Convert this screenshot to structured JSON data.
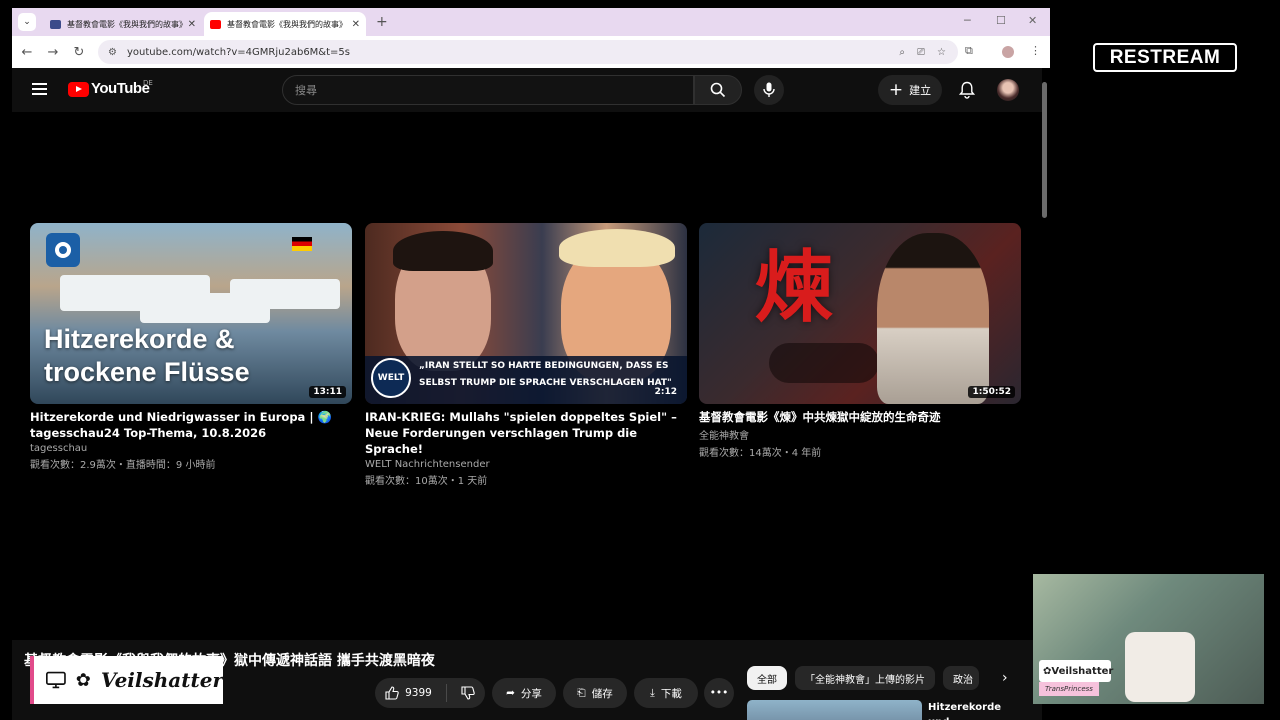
{
  "browser": {
    "tabs": [
      {
        "title": "基督教會電影《我與我們的故事》"
      },
      {
        "title": "基督教會電影《我與我們的故事》"
      }
    ],
    "url": "youtube.com/watch?v=4GMRju2ab6M&t=5s"
  },
  "youtube": {
    "logo_text": "YouTube",
    "region": "DE",
    "search_placeholder": "搜尋",
    "create_label": "建立"
  },
  "videos": [
    {
      "title": "Hitzerekorde und Niedrigwasser in Europa | 🌍 tagesschau24 Top-Thema, 10.8.2026",
      "channel": "tagesschau",
      "meta": "觀看次數：2.9萬次・直播時間：9 小時前",
      "duration": "13:11",
      "thumb_text_line1": "Hitzerekorde &",
      "thumb_text_line2": "trockene Flüsse"
    },
    {
      "title": "IRAN-KRIEG: Mullahs \"spielen doppeltes Spiel\" – Neue Forderungen verschlagen Trump die Sprache!",
      "channel": "WELT Nachrichtensender",
      "meta": "觀看次數：10萬次・1 天前",
      "duration": "2:12",
      "thumb_logo": "WELT",
      "thumb_quote_line1": "„IRAN STELLT SO HARTE BEDINGUNGEN, DASS ES",
      "thumb_quote_line2": "SELBST TRUMP DIE SPRACHE VERSCHLAGEN HAT\""
    },
    {
      "title": "基督教會電影《煉》中共煉獄中綻放的生命奇迹",
      "channel": "全能神教會",
      "meta": "觀看次數：14萬次・4 年前",
      "duration": "1:50:52",
      "thumb_glyph": "煉"
    }
  ],
  "player": {
    "title": "基督教會電影《我與我們的故事》獄中傳遞神話語 攜手共渡黑暗夜",
    "likes": "9399",
    "share_label": "分享",
    "save_label": "儲存",
    "download_label": "下載"
  },
  "chips": [
    "全部",
    "「全能神教會」上傳的影片",
    "政治"
  ],
  "recommendation": {
    "title": "Hitzerekorde und Niedrigwasser in"
  },
  "overlays": {
    "restream_label": "RESTREAM",
    "streamer_name": "Veilshatter",
    "cam_tag_name": "Veilshatter",
    "cam_tag_sub": "TransPrincess"
  },
  "colors": {
    "youtube_red": "#ff0000",
    "tab_strip": "#e8d9f0",
    "accent_pink": "#e14b8a"
  }
}
